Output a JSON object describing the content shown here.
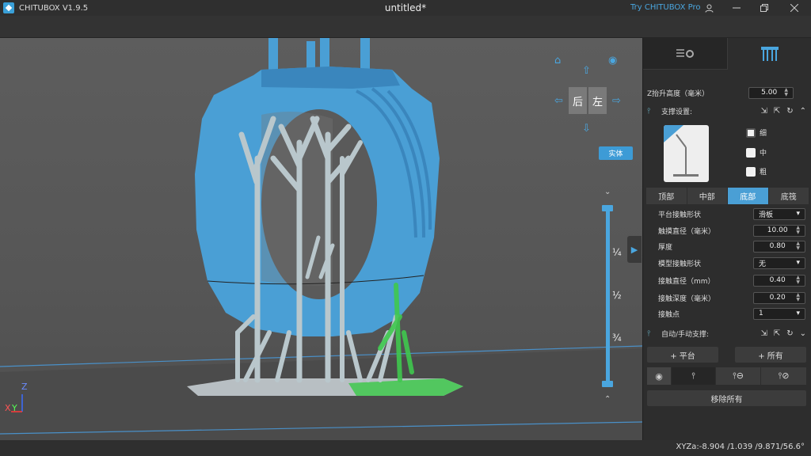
{
  "app": {
    "name": "CHITUBOX V1.9.5",
    "doc_title": "untitled*",
    "try_pro": "Try CHITUBOX Pro"
  },
  "window": {
    "minimize_icon": "minimize-icon",
    "maximize_icon": "restore-icon",
    "close_icon": "close-icon",
    "user_icon": "user-icon"
  },
  "viewport": {
    "cube": {
      "back": "后",
      "left": "左"
    },
    "solid_button": "实体",
    "slider": {
      "q1": "¼",
      "half": "½",
      "q3": "¾"
    }
  },
  "panel": {
    "z_lift": {
      "label": "Z抬升高度（毫米）",
      "value": "5.00"
    },
    "support_settings": {
      "label": "支撑设置:"
    },
    "density": {
      "fine": "细",
      "medium": "中",
      "coarse": "粗",
      "selected": "fine"
    },
    "position_tabs": [
      "顶部",
      "中部",
      "底部",
      "底筏"
    ],
    "active_tab": 2,
    "params": [
      {
        "label": "平台接触形状",
        "value": "滑板",
        "type": "select"
      },
      {
        "label": "触摸直径（毫米）",
        "value": "10.00",
        "type": "spin"
      },
      {
        "label": "厚度",
        "value": "0.80",
        "type": "spin"
      },
      {
        "label": "模型接触形状",
        "value": "无",
        "type": "select"
      },
      {
        "label": "接触直径（mm）",
        "value": "0.40",
        "type": "spin"
      },
      {
        "label": "接触深度（毫米）",
        "value": "0.20",
        "type": "spin"
      },
      {
        "label": "接触点",
        "value": "1",
        "type": "select"
      }
    ],
    "auto_manual": {
      "label": "自动/手动支撑:"
    },
    "add_platform": "+ 平台",
    "add_all": "+ 所有",
    "remove_all": "移除所有"
  },
  "status": {
    "coords": "XYZa:-8.904 /1.039 /9.871/56.6°"
  },
  "colors": {
    "accent": "#4aa6df",
    "model": "#4a9fd5",
    "support": "#b9c7cc",
    "selected": "#35c84a"
  }
}
